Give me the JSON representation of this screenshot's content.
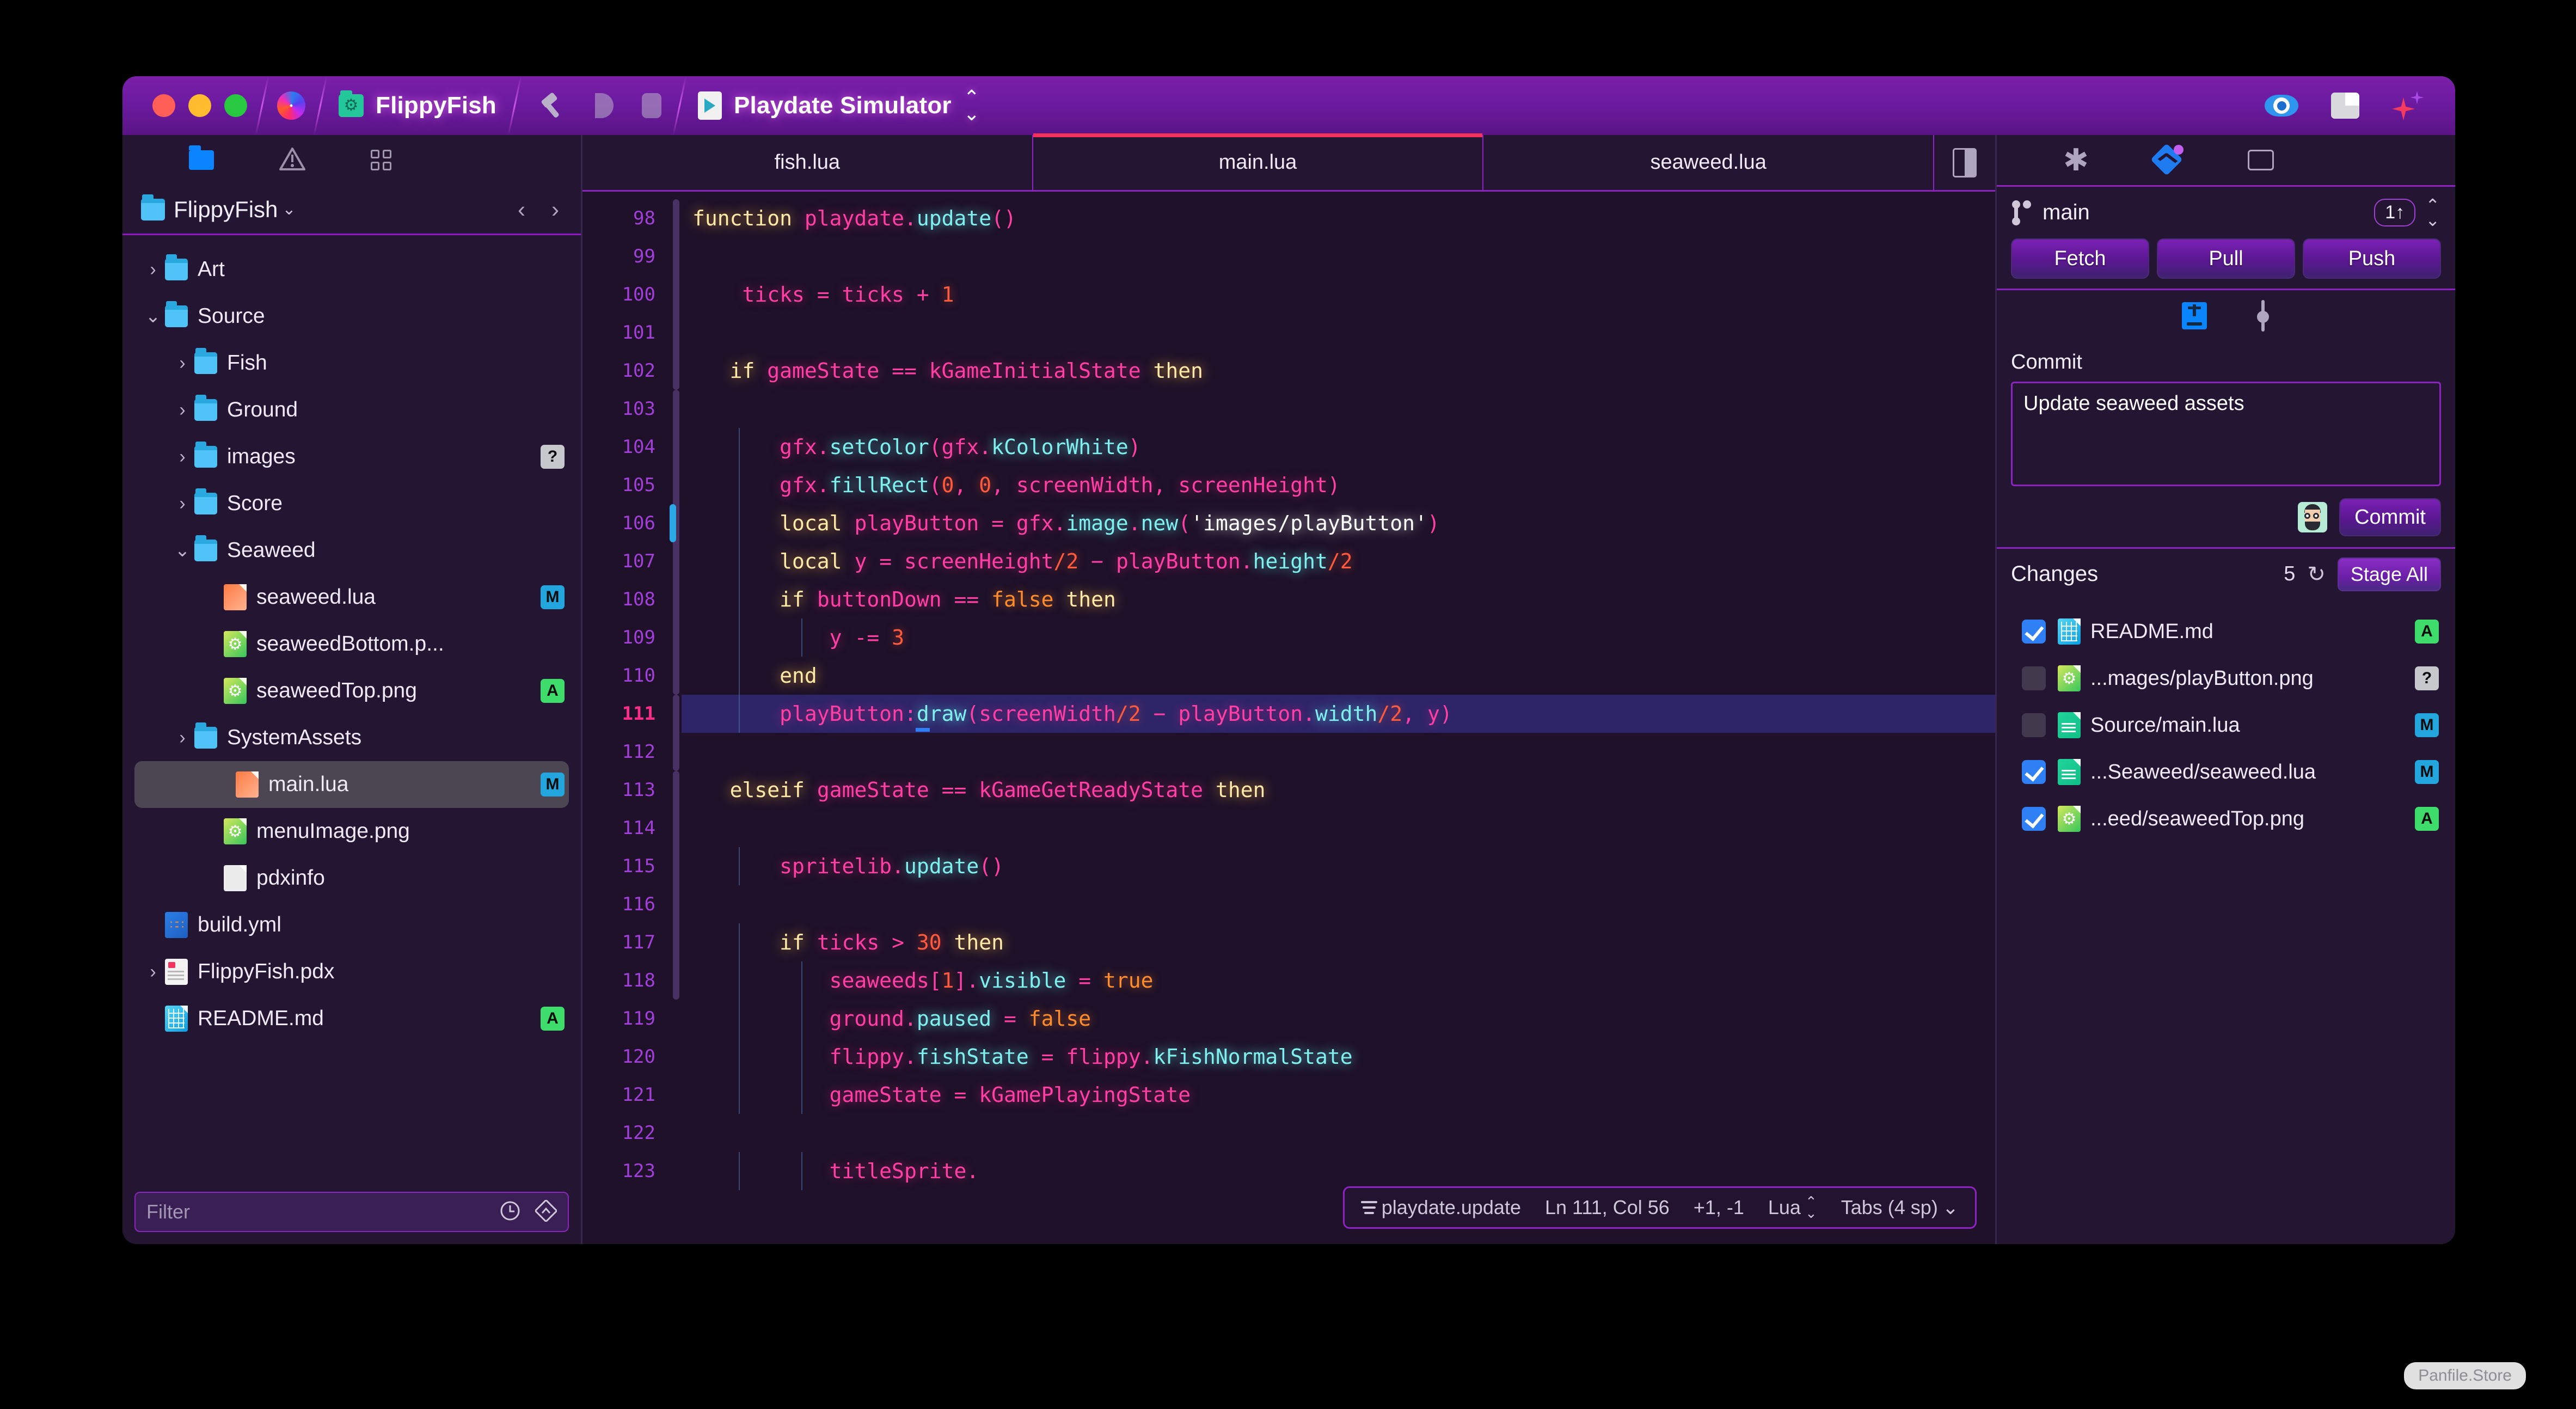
{
  "titlebar": {
    "traffic": [
      "close",
      "minimize",
      "zoom"
    ],
    "app_icon": "nova-swirl-icon",
    "project": {
      "icon": "folder-gear-icon",
      "label": "FlippyFish"
    },
    "tool_icons": [
      "hammer-icon",
      "run-icon",
      "stop-icon"
    ],
    "target": {
      "icon": "playdate-simulator-icon",
      "label": "Playdate Simulator",
      "chevron": "updown-chevron-icon"
    },
    "right_icons": [
      "eye-icon",
      "layout-panel-icon",
      "sparkles-icon"
    ]
  },
  "sidebar": {
    "toolbar_icons": [
      "files-icon",
      "issues-icon",
      "symbols-icon"
    ],
    "project_name": "FlippyFish",
    "nav_back": "‹",
    "nav_forward": "›",
    "tree": [
      {
        "indent": 0,
        "twisty": "›",
        "icon": "folder",
        "label": "Art",
        "badge": ""
      },
      {
        "indent": 0,
        "twisty": "⌄",
        "icon": "folder",
        "label": "Source",
        "badge": ""
      },
      {
        "indent": 1,
        "twisty": "›",
        "icon": "folder",
        "label": "Fish",
        "badge": ""
      },
      {
        "indent": 1,
        "twisty": "›",
        "icon": "folder",
        "label": "Ground",
        "badge": ""
      },
      {
        "indent": 1,
        "twisty": "›",
        "icon": "folder",
        "label": "images",
        "badge": "?"
      },
      {
        "indent": 1,
        "twisty": "›",
        "icon": "folder",
        "label": "Score",
        "badge": ""
      },
      {
        "indent": 1,
        "twisty": "⌄",
        "icon": "folder",
        "label": "Seaweed",
        "badge": ""
      },
      {
        "indent": 2,
        "twisty": "",
        "icon": "lua",
        "label": "seaweed.lua",
        "badge": "M"
      },
      {
        "indent": 2,
        "twisty": "",
        "icon": "png",
        "label": "seaweedBottom.p...",
        "badge": ""
      },
      {
        "indent": 2,
        "twisty": "",
        "icon": "png",
        "label": "seaweedTop.png",
        "badge": "A"
      },
      {
        "indent": 1,
        "twisty": "›",
        "icon": "folder",
        "label": "SystemAssets",
        "badge": ""
      },
      {
        "indent": 2,
        "twisty": "",
        "icon": "lua",
        "label": "main.lua",
        "badge": "M",
        "selected": true
      },
      {
        "indent": 2,
        "twisty": "",
        "icon": "png",
        "label": "menuImage.png",
        "badge": ""
      },
      {
        "indent": 2,
        "twisty": "",
        "icon": "plain",
        "label": "pdxinfo",
        "badge": ""
      },
      {
        "indent": 0,
        "twisty": "",
        "icon": "yml",
        "label": "build.yml",
        "badge": ""
      },
      {
        "indent": 0,
        "twisty": "›",
        "icon": "pdx",
        "label": "FlippyFish.pdx",
        "badge": ""
      },
      {
        "indent": 0,
        "twisty": "",
        "icon": "md",
        "label": "README.md",
        "badge": "A"
      }
    ],
    "filter": {
      "placeholder": "Filter",
      "value": "",
      "icons": [
        "recent-clock-icon",
        "scm-filter-icon"
      ]
    }
  },
  "editor": {
    "tabs": [
      {
        "label": "fish.lua",
        "active": false
      },
      {
        "label": "main.lua",
        "active": true
      },
      {
        "label": "seaweed.lua",
        "active": false
      }
    ],
    "split_toggle_icon": "split-editor-icon",
    "first_line_number": 98,
    "current_line": 111,
    "lines": [
      {
        "n": 98,
        "tokens": [
          {
            "t": "function",
            "c": "k"
          },
          {
            "t": " ",
            "c": ""
          },
          {
            "t": "playdate.",
            "c": "id"
          },
          {
            "t": "update",
            "c": "fn"
          },
          {
            "t": "()",
            "c": "pn"
          }
        ]
      },
      {
        "n": 99,
        "tokens": []
      },
      {
        "n": 100,
        "tokens": [
          {
            "t": "    ",
            "c": ""
          },
          {
            "t": "ticks",
            "c": "id"
          },
          {
            "t": " = ",
            "c": "op"
          },
          {
            "t": "ticks",
            "c": "id"
          },
          {
            "t": " + ",
            "c": "op"
          },
          {
            "t": "1",
            "c": "num"
          }
        ]
      },
      {
        "n": 101,
        "tokens": []
      },
      {
        "n": 102,
        "tokens": [
          {
            "t": "   ",
            "c": ""
          },
          {
            "t": "if",
            "c": "k"
          },
          {
            "t": " ",
            "c": ""
          },
          {
            "t": "gameState",
            "c": "id"
          },
          {
            "t": " == ",
            "c": "op"
          },
          {
            "t": "kGameInitialState",
            "c": "id"
          },
          {
            "t": " ",
            "c": ""
          },
          {
            "t": "then",
            "c": "k"
          }
        ]
      },
      {
        "n": 103,
        "tokens": []
      },
      {
        "n": 104,
        "tokens": [
          {
            "t": "       ",
            "c": ""
          },
          {
            "t": "gfx.",
            "c": "id"
          },
          {
            "t": "setColor",
            "c": "fn"
          },
          {
            "t": "(",
            "c": "pn"
          },
          {
            "t": "gfx.",
            "c": "id"
          },
          {
            "t": "kColorWhite",
            "c": "fn"
          },
          {
            "t": ")",
            "c": "pn"
          }
        ]
      },
      {
        "n": 105,
        "tokens": [
          {
            "t": "       ",
            "c": ""
          },
          {
            "t": "gfx.",
            "c": "id"
          },
          {
            "t": "fillRect",
            "c": "fn"
          },
          {
            "t": "(",
            "c": "pn"
          },
          {
            "t": "0",
            "c": "num"
          },
          {
            "t": ", ",
            "c": "pn"
          },
          {
            "t": "0",
            "c": "num"
          },
          {
            "t": ", ",
            "c": "pn"
          },
          {
            "t": "screenWidth",
            "c": "id"
          },
          {
            "t": ", ",
            "c": "pn"
          },
          {
            "t": "screenHeight",
            "c": "id"
          },
          {
            "t": ")",
            "c": "pn"
          }
        ]
      },
      {
        "n": 106,
        "tokens": [
          {
            "t": "       ",
            "c": ""
          },
          {
            "t": "local",
            "c": "k"
          },
          {
            "t": " ",
            "c": ""
          },
          {
            "t": "playButton",
            "c": "id"
          },
          {
            "t": " = ",
            "c": "op"
          },
          {
            "t": "gfx.",
            "c": "id"
          },
          {
            "t": "image",
            "c": "fn"
          },
          {
            "t": ".",
            "c": "id"
          },
          {
            "t": "new",
            "c": "fn"
          },
          {
            "t": "(",
            "c": "pn"
          },
          {
            "t": "'images/playButton'",
            "c": "str"
          },
          {
            "t": ")",
            "c": "pn"
          }
        ]
      },
      {
        "n": 107,
        "tokens": [
          {
            "t": "       ",
            "c": ""
          },
          {
            "t": "local",
            "c": "k"
          },
          {
            "t": " ",
            "c": ""
          },
          {
            "t": "y",
            "c": "id"
          },
          {
            "t": " = ",
            "c": "op"
          },
          {
            "t": "screenHeight",
            "c": "id"
          },
          {
            "t": "/",
            "c": "num"
          },
          {
            "t": "2",
            "c": "num"
          },
          {
            "t": " − ",
            "c": "op"
          },
          {
            "t": "playButton.",
            "c": "id"
          },
          {
            "t": "height",
            "c": "fn"
          },
          {
            "t": "/",
            "c": "num"
          },
          {
            "t": "2",
            "c": "num"
          }
        ]
      },
      {
        "n": 108,
        "tokens": [
          {
            "t": "       ",
            "c": ""
          },
          {
            "t": "if",
            "c": "k"
          },
          {
            "t": " ",
            "c": ""
          },
          {
            "t": "buttonDown",
            "c": "id"
          },
          {
            "t": " == ",
            "c": "op"
          },
          {
            "t": "false",
            "c": "bool"
          },
          {
            "t": " ",
            "c": ""
          },
          {
            "t": "then",
            "c": "k"
          }
        ]
      },
      {
        "n": 109,
        "tokens": [
          {
            "t": "           ",
            "c": ""
          },
          {
            "t": "y",
            "c": "id"
          },
          {
            "t": " -= ",
            "c": "op"
          },
          {
            "t": "3",
            "c": "num"
          }
        ]
      },
      {
        "n": 110,
        "tokens": [
          {
            "t": "       ",
            "c": ""
          },
          {
            "t": "end",
            "c": "k"
          }
        ]
      },
      {
        "n": 111,
        "tokens": [
          {
            "t": "       ",
            "c": ""
          },
          {
            "t": "playButton",
            "c": "id"
          },
          {
            "t": ":",
            "c": "op"
          },
          {
            "t": "draw",
            "c": "fn"
          },
          {
            "t": "(",
            "c": "pn"
          },
          {
            "t": "screenWidth",
            "c": "id"
          },
          {
            "t": "/",
            "c": "num"
          },
          {
            "t": "2",
            "c": "num"
          },
          {
            "t": " − ",
            "c": "op"
          },
          {
            "t": "playButton.",
            "c": "id"
          },
          {
            "t": "width",
            "c": "fn"
          },
          {
            "t": "/",
            "c": "num"
          },
          {
            "t": "2",
            "c": "num"
          },
          {
            "t": ", ",
            "c": "pn"
          },
          {
            "t": "y",
            "c": "id"
          },
          {
            "t": ")",
            "c": "pn"
          }
        ],
        "highlight": true
      },
      {
        "n": 112,
        "tokens": []
      },
      {
        "n": 113,
        "tokens": [
          {
            "t": "   ",
            "c": ""
          },
          {
            "t": "elseif",
            "c": "k"
          },
          {
            "t": " ",
            "c": ""
          },
          {
            "t": "gameState",
            "c": "id"
          },
          {
            "t": " == ",
            "c": "op"
          },
          {
            "t": "kGameGetReadyState",
            "c": "id"
          },
          {
            "t": " ",
            "c": ""
          },
          {
            "t": "then",
            "c": "k"
          }
        ]
      },
      {
        "n": 114,
        "tokens": []
      },
      {
        "n": 115,
        "tokens": [
          {
            "t": "       ",
            "c": ""
          },
          {
            "t": "spritelib.",
            "c": "id"
          },
          {
            "t": "update",
            "c": "fn"
          },
          {
            "t": "()",
            "c": "pn"
          }
        ]
      },
      {
        "n": 116,
        "tokens": []
      },
      {
        "n": 117,
        "tokens": [
          {
            "t": "       ",
            "c": ""
          },
          {
            "t": "if",
            "c": "k"
          },
          {
            "t": " ",
            "c": ""
          },
          {
            "t": "ticks",
            "c": "id"
          },
          {
            "t": " > ",
            "c": "op"
          },
          {
            "t": "30",
            "c": "num"
          },
          {
            "t": " ",
            "c": ""
          },
          {
            "t": "then",
            "c": "k"
          }
        ]
      },
      {
        "n": 118,
        "tokens": [
          {
            "t": "           ",
            "c": ""
          },
          {
            "t": "seaweeds",
            "c": "id"
          },
          {
            "t": "[",
            "c": "pn"
          },
          {
            "t": "1",
            "c": "num"
          },
          {
            "t": "].",
            "c": "pn"
          },
          {
            "t": "visible",
            "c": "fn"
          },
          {
            "t": " = ",
            "c": "op"
          },
          {
            "t": "true",
            "c": "bool"
          }
        ]
      },
      {
        "n": 119,
        "tokens": [
          {
            "t": "           ",
            "c": ""
          },
          {
            "t": "ground.",
            "c": "id"
          },
          {
            "t": "paused",
            "c": "fn"
          },
          {
            "t": " = ",
            "c": "op"
          },
          {
            "t": "false",
            "c": "bool"
          }
        ]
      },
      {
        "n": 120,
        "tokens": [
          {
            "t": "           ",
            "c": ""
          },
          {
            "t": "flippy.",
            "c": "id"
          },
          {
            "t": "fishState",
            "c": "fn"
          },
          {
            "t": " = ",
            "c": "op"
          },
          {
            "t": "flippy.",
            "c": "id"
          },
          {
            "t": "kFishNormalState",
            "c": "fn"
          }
        ]
      },
      {
        "n": 121,
        "tokens": [
          {
            "t": "           ",
            "c": ""
          },
          {
            "t": "gameState",
            "c": "id"
          },
          {
            "t": " = ",
            "c": "op"
          },
          {
            "t": "kGamePlayingState",
            "c": "id"
          }
        ]
      },
      {
        "n": 122,
        "tokens": []
      },
      {
        "n": 123,
        "tokens": [
          {
            "t": "           ",
            "c": ""
          },
          {
            "t": "titleSprite",
            "c": "id"
          },
          {
            "t": ".",
            "c": "pn"
          }
        ]
      }
    ],
    "statusbar": {
      "symbol_icon": "outline-icon",
      "symbol": "playdate.update",
      "position": "Ln 111, Col 56",
      "diff": "+1, -1",
      "language": "Lua",
      "language_chevron": "⌃⌄",
      "indentation": "Tabs (4 sp)",
      "indent_chevron": "⌄"
    }
  },
  "right_panel": {
    "toolbar_icons": [
      "snippets-asterisk-icon",
      "source-control-icon",
      "inspector-chip-icon"
    ],
    "branch": {
      "icon": "git-branch-icon",
      "name": "main",
      "ahead": "1↑",
      "sort_icon": "updown-chevron-icon"
    },
    "actions": [
      "Fetch",
      "Pull",
      "Push"
    ],
    "stage_icons": [
      "stage-selected-icon",
      "unstage-icon"
    ],
    "commit": {
      "label": "Commit",
      "message": "Update seaweed assets",
      "avatar": "user-avatar",
      "button": "Commit"
    },
    "changes": {
      "title": "Changes",
      "count": "5",
      "refresh_icon": "refresh-icon",
      "stage_all": "Stage All",
      "items": [
        {
          "checked": true,
          "icon": "md",
          "name": "README.md",
          "badge": "A"
        },
        {
          "checked": false,
          "icon": "png",
          "name": "...mages/playButton.png",
          "badge": "?"
        },
        {
          "checked": false,
          "icon": "luagreen",
          "name": "Source/main.lua",
          "badge": "M"
        },
        {
          "checked": true,
          "icon": "luagreen",
          "name": "...Seaweed/seaweed.lua",
          "badge": "M"
        },
        {
          "checked": true,
          "icon": "png",
          "name": "...eed/seaweedTop.png",
          "badge": "A"
        }
      ]
    }
  },
  "watermark": "Panfile.Store",
  "colors": {
    "accent_purple": "#8d23c0",
    "titlebar_purple": "#6c1ba0",
    "active_tab_underline": "#f5325b",
    "keyword": "#ffe9a8",
    "identifier": "#ff3fa4",
    "function": "#7ff0ee",
    "number": "#ff5a3c",
    "boolean": "#ff8c2b",
    "string": "#ffffff",
    "badge_modified": "#23a6de",
    "badge_added": "#3ddc6b",
    "badge_untracked": "#c6c8cc"
  }
}
